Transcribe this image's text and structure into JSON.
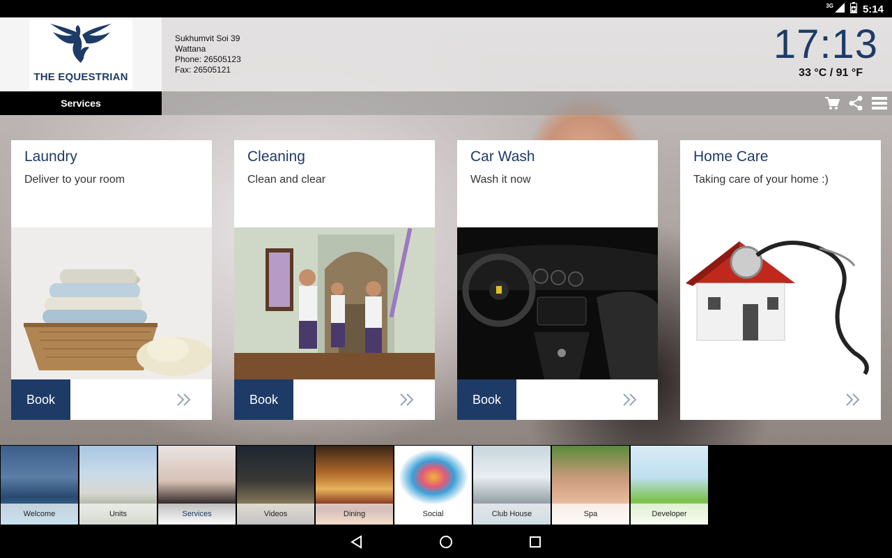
{
  "status_bar": {
    "network": "3G",
    "time": "5:14"
  },
  "brand": {
    "name": "THE EQUESTRIAN"
  },
  "contact": {
    "street": "Sukhumvit Soi 39",
    "district": "Wattana",
    "phone": "Phone: 26505123",
    "fax": "Fax: 26505121"
  },
  "clock": {
    "time": "17:13",
    "temperature": "33 °C / 91 °F"
  },
  "section_tab": "Services",
  "toolbar": {
    "icons": [
      "cart-icon",
      "share-icon",
      "menu-icon"
    ]
  },
  "cards": [
    {
      "title": "Laundry",
      "subtitle": "Deliver to your room",
      "book_label": "Book",
      "has_book": true
    },
    {
      "title": "Cleaning",
      "subtitle": "Clean and clear",
      "book_label": "Book",
      "has_book": true
    },
    {
      "title": "Car Wash",
      "subtitle": "Wash it now",
      "book_label": "Book",
      "has_book": true
    },
    {
      "title": "Home Care",
      "subtitle": "Taking care of your home :)",
      "book_label": "",
      "has_book": false
    }
  ],
  "nav_items": [
    {
      "label": "Welcome"
    },
    {
      "label": "Units"
    },
    {
      "label": "Services",
      "active": true
    },
    {
      "label": "Videos"
    },
    {
      "label": "Dining"
    },
    {
      "label": "Social"
    },
    {
      "label": "Club House"
    },
    {
      "label": "Spa"
    },
    {
      "label": "Developer"
    }
  ],
  "colors": {
    "brand_blue": "#1d3b66",
    "card_bg": "#ffffff",
    "tab_bg": "#000000"
  }
}
